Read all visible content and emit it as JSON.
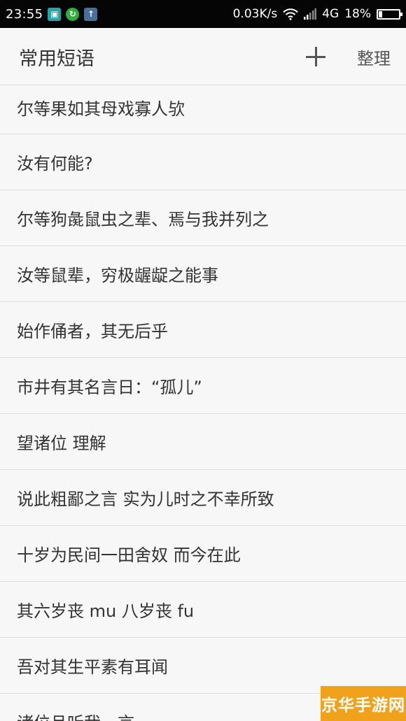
{
  "status_bar": {
    "time": "23:55",
    "notification_icons": [
      "app-notification-icon",
      "refresh-notification-icon",
      "upload-notification-icon"
    ],
    "network_speed": "0.03K/s",
    "network_type": "4G",
    "battery_level": "18%",
    "battery_fraction": 0.18
  },
  "app_bar": {
    "title": "常用短语",
    "add_label": "+",
    "organize_label": "整理"
  },
  "phrases": [
    "尔等果如其母戏寡人欤",
    "汝有何能?",
    "尔等狗彘鼠虫之辈、焉与我并列之",
    "汝等鼠辈，穷极龌龊之能事",
    "始作俑者，其无后乎",
    "市井有其名言日：“孤儿”",
    "望诸位 理解",
    "说此粗鄙之言 实为儿时之不幸所致",
    "十岁为民间一田舍奴 而今在此",
    "其六岁丧  mu  八岁丧  fu",
    "吾对其生平素有耳闻",
    "诸位且听我一言"
  ],
  "watermark": {
    "text": "京华手游网"
  },
  "colors": {
    "status_bar_bg": "#050505",
    "background": "#f7f7f7",
    "text": "#333333",
    "divider": "#dedede",
    "watermark_bg": "#f0a21c"
  }
}
